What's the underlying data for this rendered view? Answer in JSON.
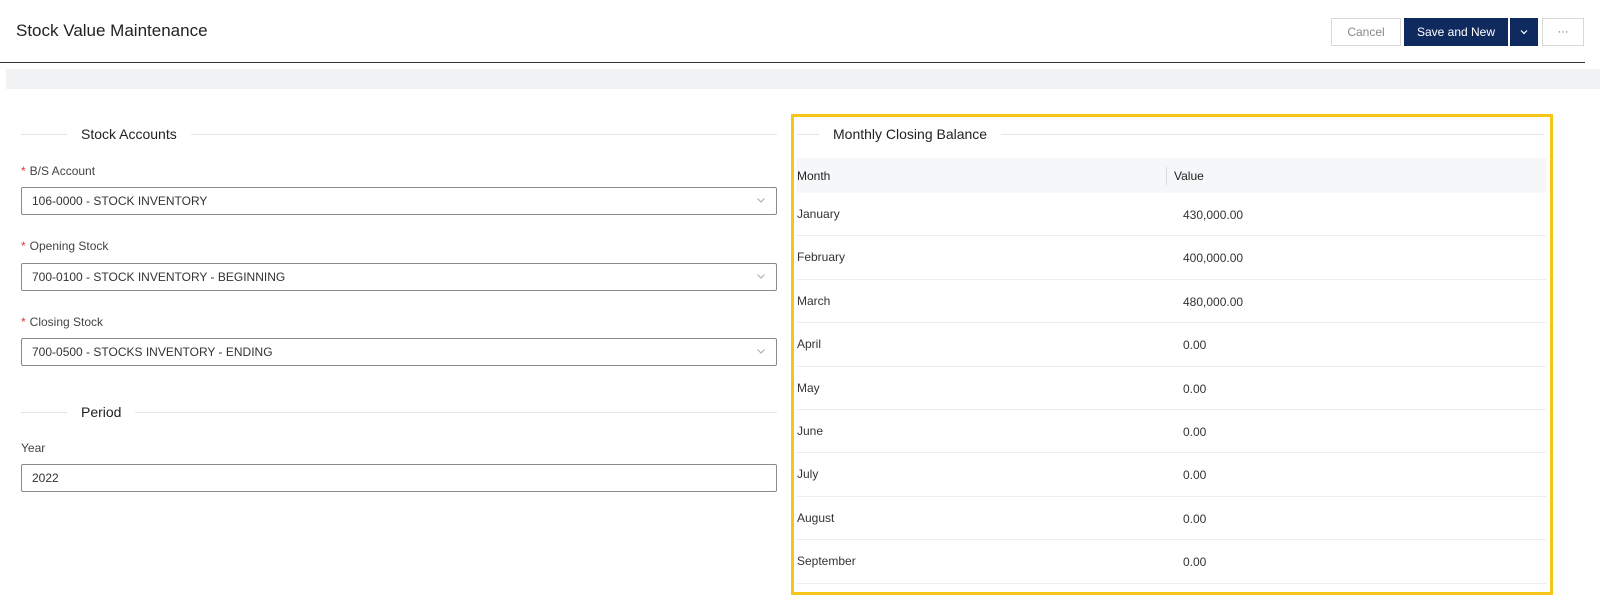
{
  "header": {
    "title": "Stock Value Maintenance",
    "cancel_label": "Cancel",
    "save_label": "Save and New",
    "dropdown_label": "v",
    "more_label": "···"
  },
  "stock_accounts": {
    "heading": "Stock Accounts",
    "bs_account": {
      "label": "B/S Account",
      "value": "106-0000 - STOCK INVENTORY"
    },
    "opening_stock": {
      "label": "Opening Stock",
      "value": "700-0100 - STOCK INVENTORY - BEGINNING"
    },
    "closing_stock": {
      "label": "Closing Stock",
      "value": "700-0500 - STOCKS INVENTORY - ENDING"
    }
  },
  "period": {
    "heading": "Period",
    "year": {
      "label": "Year",
      "value": "2022"
    }
  },
  "monthly_closing": {
    "heading": "Monthly Closing Balance",
    "columns": [
      "Month",
      "Value"
    ],
    "rows": [
      {
        "month": "January",
        "value": "430,000.00"
      },
      {
        "month": "February",
        "value": "400,000.00"
      },
      {
        "month": "March",
        "value": "480,000.00"
      },
      {
        "month": "April",
        "value": "0.00"
      },
      {
        "month": "May",
        "value": "0.00"
      },
      {
        "month": "June",
        "value": "0.00"
      },
      {
        "month": "July",
        "value": "0.00"
      },
      {
        "month": "August",
        "value": "0.00"
      },
      {
        "month": "September",
        "value": "0.00"
      }
    ]
  },
  "colors": {
    "primary": "#0f2a5e",
    "highlight": "#f5c518",
    "required": "#e0393e"
  }
}
